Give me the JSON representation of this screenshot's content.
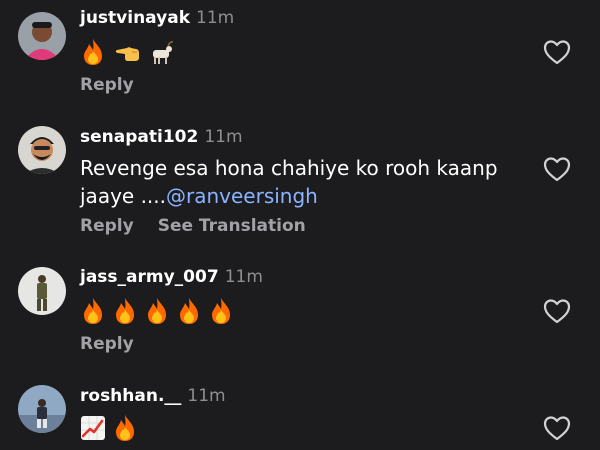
{
  "comments": [
    {
      "username": "justvinayak",
      "time": "11m",
      "text": "",
      "emojis": [
        "fire-emoji",
        "backhand-index-left-emoji",
        "goat-emoji"
      ],
      "actions": [
        "Reply"
      ]
    },
    {
      "username": "senapati102",
      "time": "11m",
      "text": "Revenge esa hona chahiye ko rooh kaanp jaaye ....",
      "mention": "@ranveersingh",
      "emojis": [],
      "actions": [
        "Reply",
        "See Translation"
      ]
    },
    {
      "username": "jass_army_007",
      "time": "11m",
      "text": "",
      "emojis": [
        "fire-emoji",
        "fire-emoji",
        "fire-emoji",
        "fire-emoji",
        "fire-emoji"
      ],
      "actions": [
        "Reply"
      ]
    },
    {
      "username": "roshhan.__",
      "time": "11m",
      "text": "",
      "emojis": [
        "chart-increasing-emoji",
        "fire-emoji"
      ],
      "actions": []
    }
  ],
  "icons": {
    "heart": "heart-outline-icon"
  },
  "colors": {
    "background": "#1c1c1e",
    "username": "#ffffff",
    "secondary": "#8e8e93",
    "mention": "#8ab4ff",
    "fire": "#ff6a00"
  }
}
